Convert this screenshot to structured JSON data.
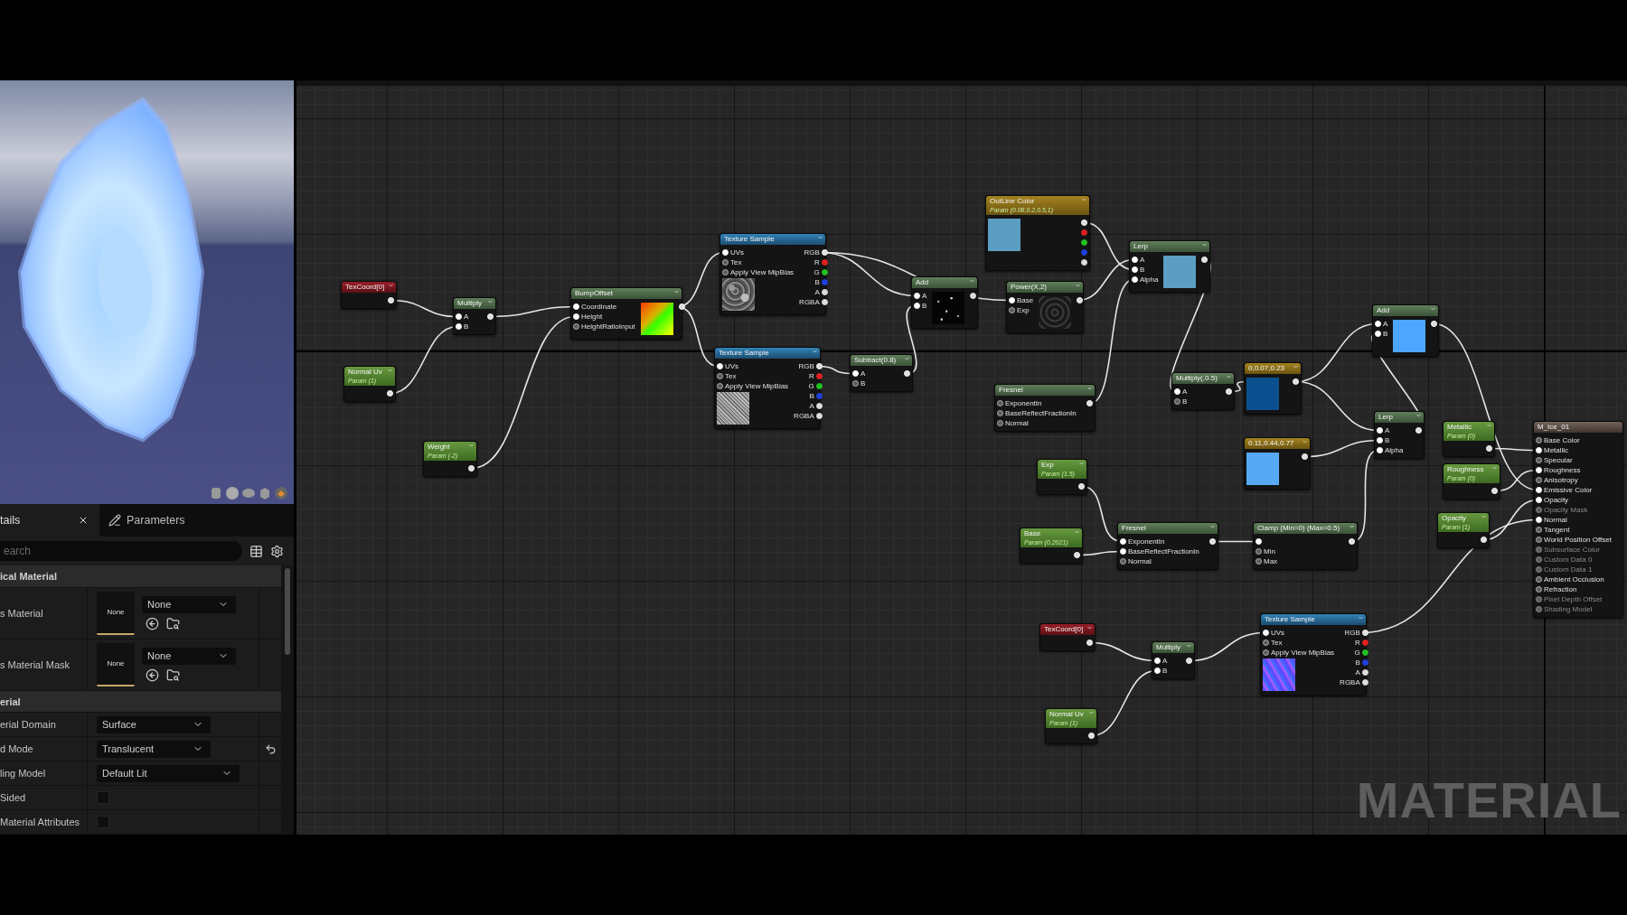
{
  "details": {
    "tabs": [
      {
        "label": "tails",
        "selected": true,
        "closable": true
      },
      {
        "label": "Parameters",
        "selected": false
      }
    ],
    "search": {
      "placeholder": "earch"
    },
    "sections": [
      {
        "title": "ical Material",
        "rows": [
          {
            "kind": "asset",
            "label": "s Material",
            "thumbnail": "None",
            "value": "None"
          },
          {
            "kind": "asset",
            "label": "s Material Mask",
            "thumbnail": "None",
            "value": "None"
          }
        ]
      },
      {
        "title": "erial",
        "rows": [
          {
            "kind": "dropdown",
            "label": "erial Domain",
            "value": "Surface"
          },
          {
            "kind": "dropdown",
            "label": "d Mode",
            "value": "Translucent",
            "reset": true
          },
          {
            "kind": "dropdown",
            "label": "ling Model",
            "value": "Default Lit"
          },
          {
            "kind": "checkbox",
            "label": "Sided",
            "checked": false
          },
          {
            "kind": "checkbox",
            "label": "Material Attributes",
            "checked": false
          }
        ]
      }
    ]
  },
  "graph": {
    "watermark": "MATERIAL",
    "nodes": [
      {
        "kind": "coord",
        "title": "TexCoord[0]",
        "outputs": [
          {
            "color": "#dddddd"
          }
        ]
      },
      {
        "kind": "math",
        "title": "Multiply",
        "inputs": [
          {
            "label": "A"
          },
          {
            "label": "B"
          }
        ],
        "outputs": [
          {
            "color": "#dddddd"
          }
        ]
      },
      {
        "kind": "param",
        "title": "Normal Uv",
        "subtitle": "Param (1)",
        "outputs": [
          {
            "color": "#dddddd"
          }
        ]
      },
      {
        "kind": "param",
        "title": "Weight",
        "subtitle": "Param (-2)",
        "outputs": [
          {
            "color": "#dddddd"
          }
        ]
      },
      {
        "kind": "math",
        "title": "BumpOffset",
        "inputs": [
          {
            "label": "Coordinate"
          },
          {
            "label": "Height"
          },
          {
            "label": "HeightRatioInput"
          }
        ],
        "outputs": [
          {
            "color": "#dddddd"
          }
        ],
        "preview": {
          "kind": "gradient"
        }
      },
      {
        "kind": "texture",
        "title": "Texture Sample",
        "inputs": [
          {
            "label": "UVs"
          },
          {
            "label": "Tex"
          },
          {
            "label": "Apply View MipBias"
          }
        ],
        "outputs": [
          {
            "label": "RGB",
            "color": "#dddddd"
          },
          {
            "label": "R",
            "color": "#e02020"
          },
          {
            "label": "G",
            "color": "#20c020"
          },
          {
            "label": "B",
            "color": "#2040e0"
          },
          {
            "label": "A",
            "color": "#dddddd"
          },
          {
            "label": "RGBA",
            "color": "#dddddd"
          }
        ],
        "preview": {
          "kind": "mottled"
        }
      },
      {
        "kind": "texture",
        "title": "Texture Sample",
        "inputs": [
          {
            "label": "UVs"
          },
          {
            "label": "Tex"
          },
          {
            "label": "Apply View MipBias"
          }
        ],
        "outputs": [
          {
            "label": "RGB",
            "color": "#dddddd"
          },
          {
            "label": "R",
            "color": "#e02020"
          },
          {
            "label": "G",
            "color": "#20c020"
          },
          {
            "label": "B",
            "color": "#2040e0"
          },
          {
            "label": "A",
            "color": "#dddddd"
          },
          {
            "label": "RGBA",
            "color": "#dddddd"
          }
        ],
        "preview": {
          "kind": "fine_noise"
        }
      },
      {
        "kind": "math",
        "title": "Add",
        "inputs": [
          {
            "label": "A"
          },
          {
            "label": "B"
          }
        ],
        "outputs": [
          {
            "color": "#dddddd"
          }
        ],
        "preview": {
          "kind": "specks"
        }
      },
      {
        "kind": "math",
        "title": "Subtract(0.8)",
        "inputs": [
          {
            "label": "A"
          },
          {
            "label": "B"
          }
        ],
        "outputs": [
          {
            "color": "#dddddd"
          }
        ]
      },
      {
        "kind": "constant",
        "title": "OutLine Color",
        "subtitle": "Param (0.08,0.2,0.5,1)",
        "outputs": [
          {
            "color": "#dddddd"
          },
          {
            "color": "#e02020"
          },
          {
            "color": "#20c020"
          },
          {
            "color": "#2040e0"
          },
          {
            "color": "#dddddd"
          }
        ],
        "preview": {
          "kind": "swatch",
          "color": "#5b9dc3"
        }
      },
      {
        "kind": "math",
        "title": "Power(X,2)",
        "inputs": [
          {
            "label": "Base"
          },
          {
            "label": "Exp"
          }
        ],
        "outputs": [
          {
            "color": "#dddddd"
          }
        ],
        "preview": {
          "kind": "dark_mottled"
        }
      },
      {
        "kind": "math",
        "title": "Lerp",
        "inputs": [
          {
            "label": "A"
          },
          {
            "label": "B"
          },
          {
            "label": "Alpha"
          }
        ],
        "outputs": [
          {
            "color": "#dddddd"
          }
        ],
        "preview": {
          "kind": "swatch",
          "color": "#5b9dc3"
        }
      },
      {
        "kind": "math",
        "title": "Fresnel",
        "inputs": [
          {
            "label": "ExponentIn"
          },
          {
            "label": "BaseReflectFractionIn"
          },
          {
            "label": "Normal"
          }
        ],
        "outputs": [
          {
            "color": "#dddddd"
          }
        ]
      },
      {
        "kind": "math",
        "title": "Multiply(,0.5)",
        "inputs": [
          {
            "label": "A"
          },
          {
            "label": "B"
          }
        ],
        "outputs": [
          {
            "color": "#dddddd"
          }
        ]
      },
      {
        "kind": "constant",
        "title": "0,0.07,0.23",
        "outputs": [
          {
            "color": "#dddddd"
          }
        ],
        "preview": {
          "kind": "swatch",
          "color": "#0c4f8e"
        }
      },
      {
        "kind": "math",
        "title": "Add",
        "inputs": [
          {
            "label": "A"
          },
          {
            "label": "B"
          }
        ],
        "outputs": [
          {
            "color": "#dddddd"
          }
        ],
        "preview": {
          "kind": "swatch",
          "color": "#4da6ff"
        }
      },
      {
        "kind": "constant",
        "title": "0.11,0.44,0.77",
        "outputs": [
          {
            "color": "#dddddd"
          }
        ],
        "preview": {
          "kind": "swatch",
          "color": "#56a9f5"
        }
      },
      {
        "kind": "math",
        "title": "Lerp",
        "inputs": [
          {
            "label": "A"
          },
          {
            "label": "B"
          },
          {
            "label": "Alpha"
          }
        ],
        "outputs": [
          {
            "color": "#dddddd"
          }
        ]
      },
      {
        "kind": "param",
        "title": "Exp",
        "subtitle": "Param (1.5)",
        "outputs": [
          {
            "color": "#dddddd"
          }
        ]
      },
      {
        "kind": "param",
        "title": "Base",
        "subtitle": "Param (0.2021)",
        "outputs": [
          {
            "color": "#dddddd"
          }
        ]
      },
      {
        "kind": "math",
        "title": "Fresnel",
        "inputs": [
          {
            "label": "ExponentIn"
          },
          {
            "label": "BaseReflectFractionIn"
          },
          {
            "label": "Normal"
          }
        ],
        "outputs": [
          {
            "color": "#dddddd"
          }
        ]
      },
      {
        "kind": "math",
        "title": "Clamp (Min=0) (Max=0.5)",
        "inputs": [
          {
            "kind": "unlabeled"
          },
          {
            "kind": "labeled",
            "label": "Min"
          },
          {
            "kind": "labeled",
            "label": "Max"
          }
        ],
        "outputs": [
          {
            "color": "#dddddd"
          }
        ]
      },
      {
        "kind": "param",
        "title": "Metallic",
        "subtitle": "Param (0)",
        "outputs": [
          {
            "color": "#dddddd"
          }
        ]
      },
      {
        "kind": "param",
        "title": "Roughness",
        "subtitle": "Param (0)",
        "outputs": [
          {
            "color": "#dddddd"
          }
        ]
      },
      {
        "kind": "param",
        "title": "Opacity",
        "subtitle": "Param (1)",
        "outputs": [
          {
            "color": "#dddddd"
          }
        ]
      },
      {
        "kind": "output",
        "title": "M_Ice_01",
        "inputs": [
          {
            "label": "Base Color",
            "disabled": false
          },
          {
            "label": "Metallic",
            "disabled": false
          },
          {
            "label": "Specular",
            "disabled": false
          },
          {
            "label": "Roughness",
            "disabled": false
          },
          {
            "label": "Anisotropy",
            "disabled": false
          },
          {
            "label": "Emissive Color",
            "disabled": false
          },
          {
            "label": "Opacity",
            "disabled": false
          },
          {
            "label": "Opacity Mask",
            "disabled": true
          },
          {
            "label": "Normal",
            "disabled": false
          },
          {
            "label": "Tangent",
            "disabled": false
          },
          {
            "label": "World Position Offset",
            "disabled": false
          },
          {
            "label": "Subsurface Color",
            "disabled": true
          },
          {
            "label": "Custom Data 0",
            "disabled": true
          },
          {
            "label": "Custom Data 1",
            "disabled": true
          },
          {
            "label": "Ambient Occlusion",
            "disabled": false
          },
          {
            "label": "Refraction",
            "disabled": false
          },
          {
            "label": "Pixel Depth Offset",
            "disabled": true
          },
          {
            "label": "Shading Model",
            "disabled": true
          }
        ]
      },
      {
        "kind": "coord",
        "title": "TexCoord[0]",
        "outputs": [
          {
            "color": "#dddddd"
          }
        ]
      },
      {
        "kind": "math",
        "title": "Multiply",
        "inputs": [
          {
            "label": "A"
          },
          {
            "label": "B"
          }
        ],
        "outputs": [
          {
            "color": "#dddddd"
          }
        ]
      },
      {
        "kind": "param",
        "title": "Normal Uv",
        "subtitle": "Param (1)",
        "outputs": [
          {
            "color": "#dddddd"
          }
        ]
      },
      {
        "kind": "texture",
        "title": "Texture Sample",
        "inputs": [
          {
            "label": "UVs"
          },
          {
            "label": "Tex"
          },
          {
            "label": "Apply View MipBias"
          }
        ],
        "outputs": [
          {
            "label": "RGB",
            "color": "#dddddd"
          },
          {
            "label": "R",
            "color": "#e02020"
          },
          {
            "label": "G",
            "color": "#20c020"
          },
          {
            "label": "B",
            "color": "#2040e0"
          },
          {
            "label": "A",
            "color": "#dddddd"
          },
          {
            "label": "RGBA",
            "color": "#dddddd"
          }
        ],
        "preview": {
          "kind": "normal_map"
        }
      }
    ]
  }
}
